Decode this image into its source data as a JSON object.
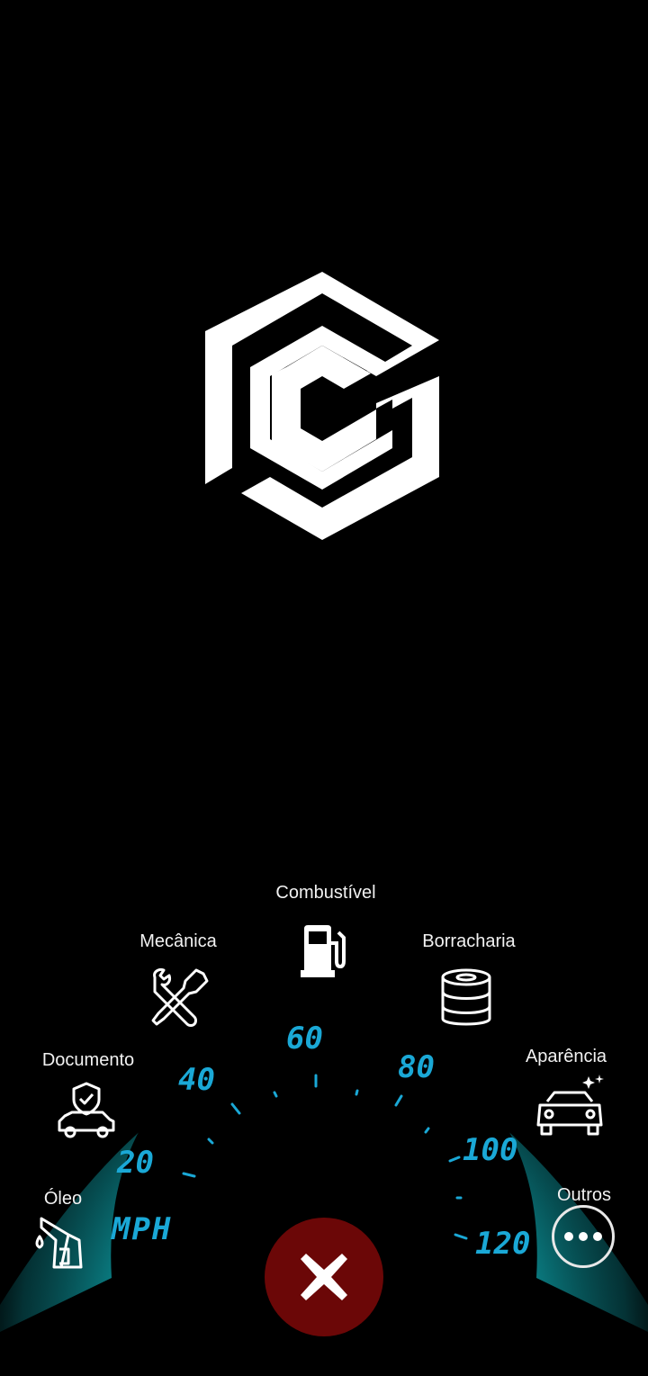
{
  "logo": {
    "icon": "hexagon-c-logo",
    "color": "#ffffff"
  },
  "gauge": {
    "unit": "MPH",
    "ticks": [
      "20",
      "40",
      "60",
      "80",
      "100",
      "120"
    ],
    "accent_color": "#1aa8d6",
    "glow_color": "#0fa3a8"
  },
  "menu": [
    {
      "id": "oleo",
      "label": "Óleo",
      "icon": "oil-pump-icon"
    },
    {
      "id": "documento",
      "label": "Documento",
      "icon": "car-shield-icon"
    },
    {
      "id": "mecanica",
      "label": "Mecânica",
      "icon": "wrench-screwdriver-icon"
    },
    {
      "id": "combustivel",
      "label": "Combustível",
      "icon": "fuel-pump-icon"
    },
    {
      "id": "borracharia",
      "label": "Borracharia",
      "icon": "tire-stack-icon"
    },
    {
      "id": "aparencia",
      "label": "Aparência",
      "icon": "shiny-car-icon"
    },
    {
      "id": "outros",
      "label": "Outros",
      "icon": "more-dots-icon"
    }
  ],
  "close_button": {
    "icon": "close-icon",
    "color": "#6b0707"
  }
}
